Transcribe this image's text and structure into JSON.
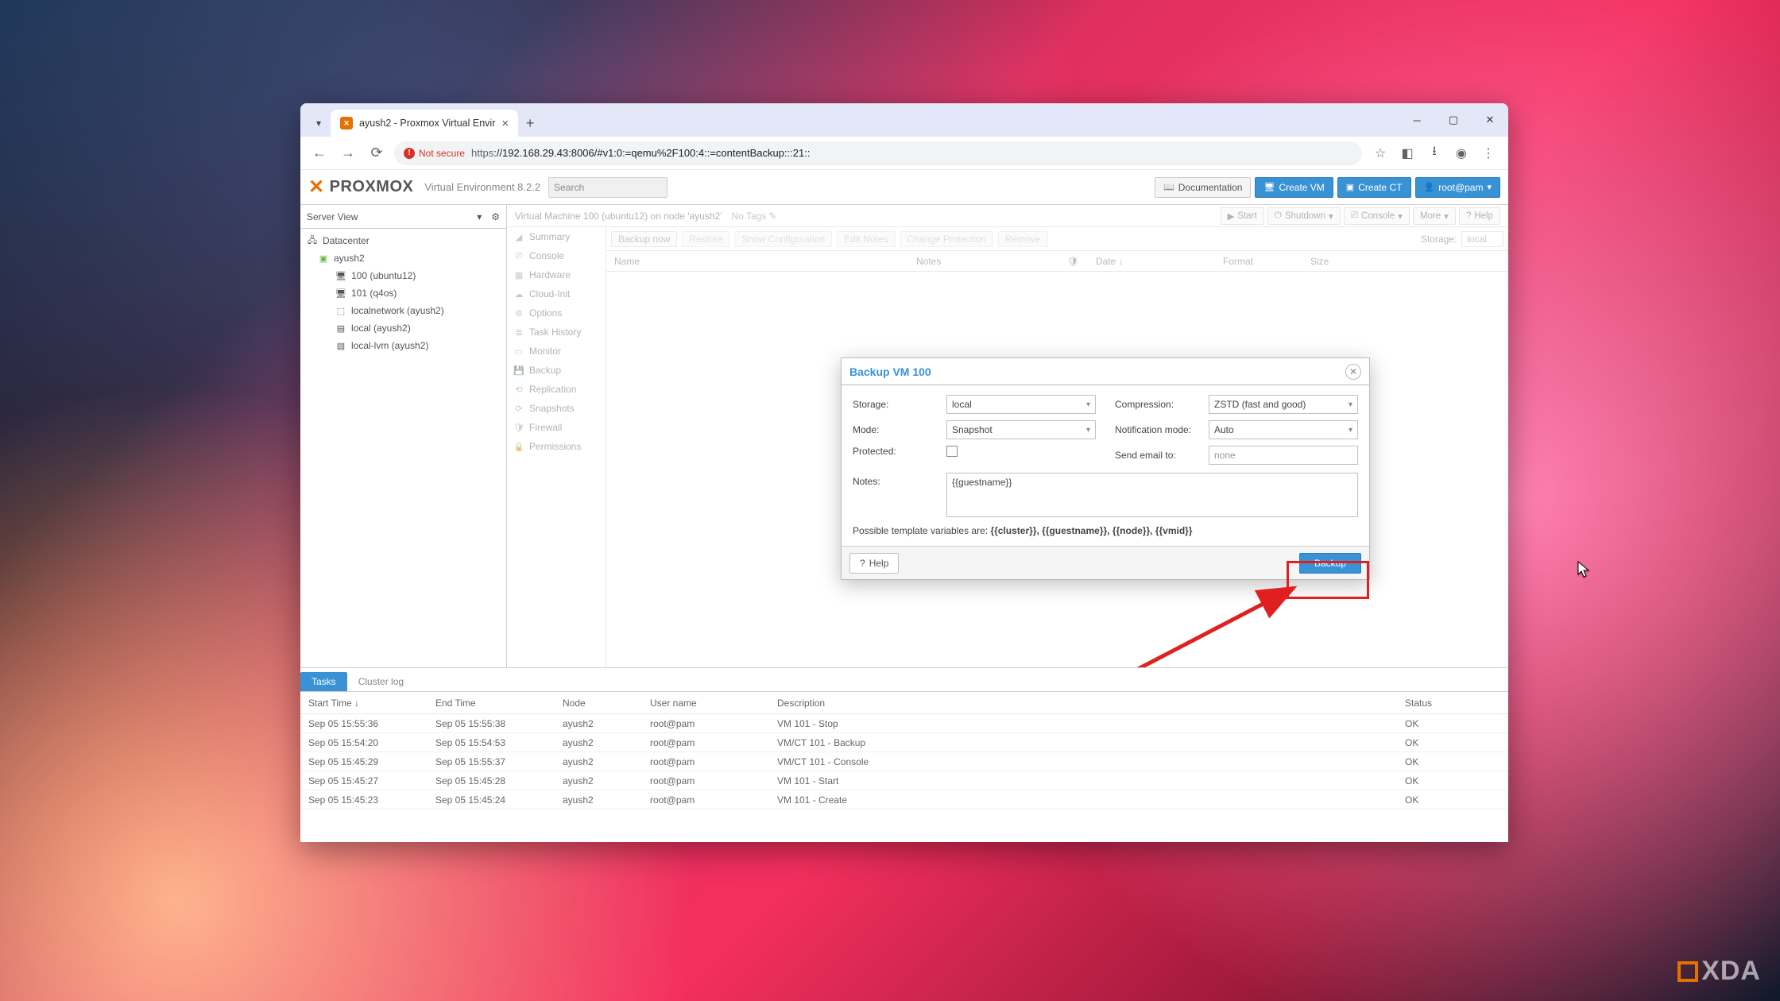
{
  "browser": {
    "tab_title": "ayush2 - Proxmox Virtual Envir",
    "insecure_label": "Not secure",
    "url_https": "https",
    "url_host": "://192.168.29.43:8006/#v1:0:=qemu%2F100:4::=contentBackup:::21::"
  },
  "pve": {
    "logo_text": "PROXMOX",
    "version": "Virtual Environment 8.2.2",
    "search_placeholder": "Search",
    "header_buttons": {
      "doc": "Documentation",
      "create_vm": "Create VM",
      "create_ct": "Create CT",
      "user": "root@pam"
    }
  },
  "sidebar": {
    "view_label": "Server View",
    "tree": {
      "datacenter": "Datacenter",
      "node": "ayush2",
      "items": [
        "100 (ubuntu12)",
        "101 (q4os)",
        "localnetwork (ayush2)",
        "local (ayush2)",
        "local-lvm (ayush2)"
      ]
    }
  },
  "main_header": {
    "title": "Virtual Machine 100 (ubuntu12) on node 'ayush2'",
    "tags_label": "No Tags",
    "buttons": {
      "start": "Start",
      "shutdown": "Shutdown",
      "console": "Console",
      "more": "More",
      "help": "Help"
    }
  },
  "menu": [
    "Summary",
    "Console",
    "Hardware",
    "Cloud-Init",
    "Options",
    "Task History",
    "Monitor",
    "Backup",
    "Replication",
    "Snapshots",
    "Firewall",
    "Permissions"
  ],
  "grid": {
    "toolbar": {
      "backup_now": "Backup now",
      "restore": "Restore",
      "show_config": "Show Configuration",
      "edit_notes": "Edit Notes",
      "change_prot": "Change Protection",
      "remove": "Remove",
      "storage_label": "Storage:",
      "storage_value": "local"
    },
    "columns": {
      "name": "Name",
      "notes": "Notes",
      "protected": "",
      "date": "Date",
      "format": "Format",
      "size": "Size"
    }
  },
  "modal": {
    "title": "Backup VM 100",
    "labels": {
      "storage": "Storage:",
      "mode": "Mode:",
      "protected": "Protected:",
      "compression": "Compression:",
      "notification": "Notification mode:",
      "email": "Send email to:",
      "notes": "Notes:"
    },
    "values": {
      "storage": "local",
      "mode": "Snapshot",
      "compression": "ZSTD (fast and good)",
      "notification": "Auto",
      "email": "none",
      "notes": "{{guestname}}"
    },
    "hint_prefix": "Possible template variables are: ",
    "hint_vars": "{{cluster}}, {{guestname}}, {{node}}, {{vmid}}",
    "help_btn": "Help",
    "backup_btn": "Backup"
  },
  "tasks": {
    "tabs": {
      "tasks": "Tasks",
      "cluster_log": "Cluster log"
    },
    "columns": {
      "start": "Start Time",
      "end": "End Time",
      "node": "Node",
      "user": "User name",
      "desc": "Description",
      "status": "Status"
    },
    "rows": [
      {
        "start": "Sep 05 15:55:36",
        "end": "Sep 05 15:55:38",
        "node": "ayush2",
        "user": "root@pam",
        "desc": "VM 101 - Stop",
        "status": "OK"
      },
      {
        "start": "Sep 05 15:54:20",
        "end": "Sep 05 15:54:53",
        "node": "ayush2",
        "user": "root@pam",
        "desc": "VM/CT 101 - Backup",
        "status": "OK"
      },
      {
        "start": "Sep 05 15:45:29",
        "end": "Sep 05 15:55:37",
        "node": "ayush2",
        "user": "root@pam",
        "desc": "VM/CT 101 - Console",
        "status": "OK"
      },
      {
        "start": "Sep 05 15:45:27",
        "end": "Sep 05 15:45:28",
        "node": "ayush2",
        "user": "root@pam",
        "desc": "VM 101 - Start",
        "status": "OK"
      },
      {
        "start": "Sep 05 15:45:23",
        "end": "Sep 05 15:45:24",
        "node": "ayush2",
        "user": "root@pam",
        "desc": "VM 101 - Create",
        "status": "OK"
      }
    ]
  },
  "watermark": "XDA"
}
